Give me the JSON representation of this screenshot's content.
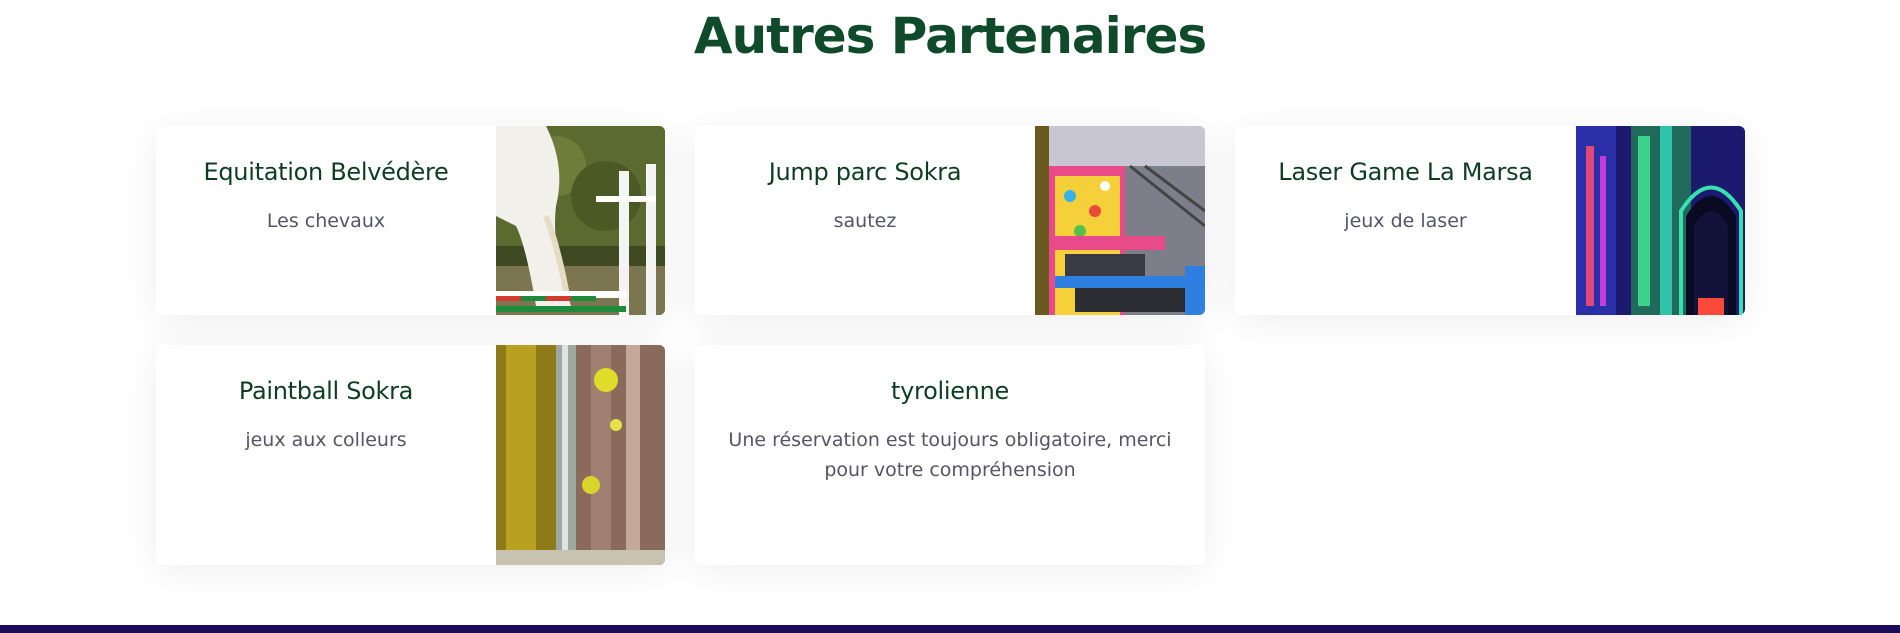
{
  "section": {
    "title": "Autres Partenaires"
  },
  "partners": [
    {
      "name": "Equitation Belvédère",
      "description": "Les chevaux",
      "image_icon": "horse-jumping-photo"
    },
    {
      "name": "Jump parc Sokra",
      "description": "sautez",
      "image_icon": "trampoline-park-photo"
    },
    {
      "name": "Laser Game La Marsa",
      "description": "jeux de laser",
      "image_icon": "laser-arena-photo"
    },
    {
      "name": "Paintball Sokra",
      "description": "jeux aux colleurs",
      "image_icon": "paintball-photo"
    },
    {
      "name": "tyrolienne",
      "description": "Une réservation est toujours obligatoire, merci pour votre compréhension",
      "image_icon": ""
    }
  ],
  "colors": {
    "title": "#0f4a2a",
    "card_title": "#0f3d24",
    "card_text": "#555566",
    "footer": "#1c0d5a"
  }
}
